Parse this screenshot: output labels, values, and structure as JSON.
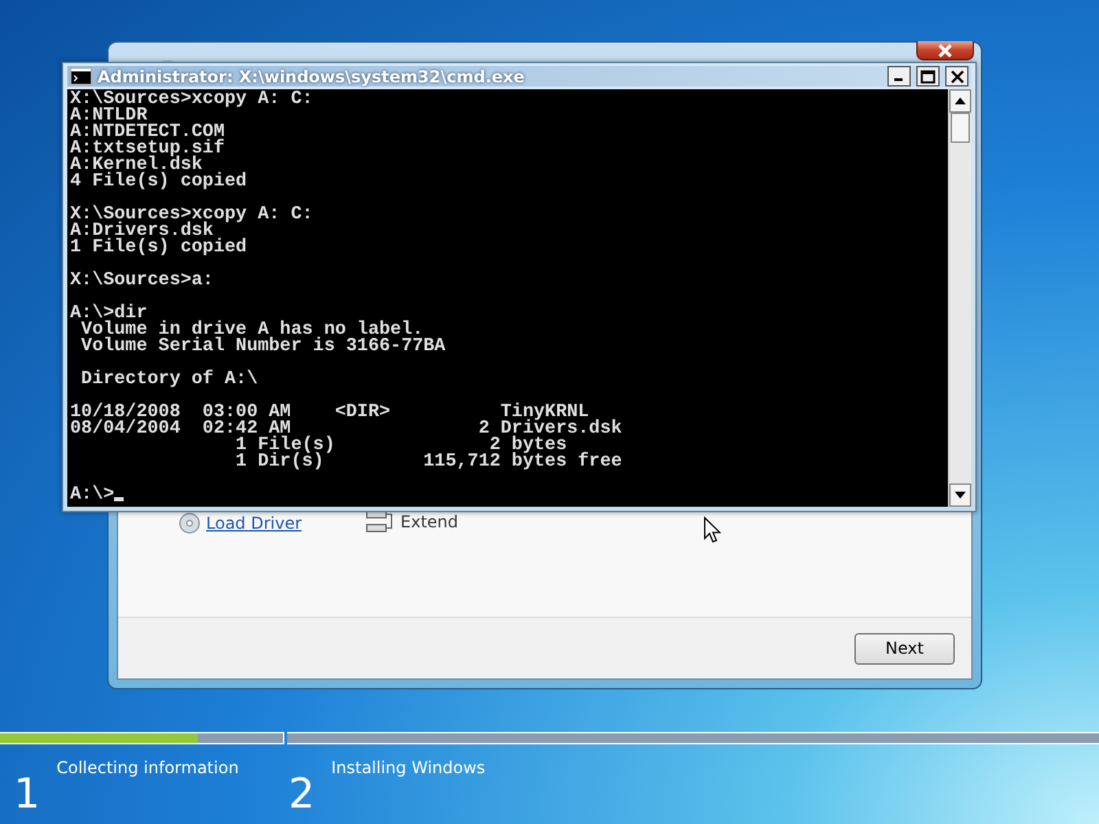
{
  "setup_window": {
    "links": [
      {
        "kind": "driver",
        "label": "Load Driver"
      },
      {
        "kind": "extend",
        "label": "Extend"
      }
    ],
    "next_button": "Next"
  },
  "console_window": {
    "title": "Administrator: X:\\windows\\system32\\cmd.exe",
    "blocks": [
      [
        "X:\\Sources>xcopy A: C:",
        "A:NTLDR",
        "A:NTDETECT.COM",
        "A:txtsetup.sif",
        "A:Kernel.dsk",
        "4 File(s) copied"
      ],
      [
        "X:\\Sources>xcopy A: C:",
        "A:Drivers.dsk",
        "1 File(s) copied"
      ],
      [
        "X:\\Sources>a:"
      ],
      [
        "A:\\>dir",
        " Volume in drive A has no label.",
        " Volume Serial Number is 3166-77BA"
      ],
      [
        " Directory of A:\\"
      ],
      [
        "10/18/2008  03:00 AM    <DIR>          TinyKRNL",
        "08/04/2004  02:42 AM                 2 Drivers.dsk",
        "               1 File(s)              2 bytes",
        "               1 Dir(s)         115,712 bytes free"
      ],
      [
        "A:\\>"
      ]
    ]
  },
  "steps": [
    {
      "number": "1",
      "label": "Collecting information",
      "level": 0.7
    },
    {
      "number": "2",
      "label": "Installing Windows",
      "level": 0
    }
  ]
}
